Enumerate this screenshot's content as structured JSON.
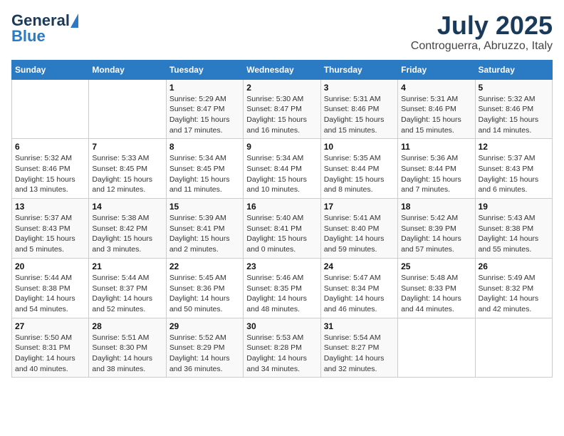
{
  "header": {
    "logo_general": "General",
    "logo_blue": "Blue",
    "title": "July 2025",
    "subtitle": "Controguerra, Abruzzo, Italy"
  },
  "weekdays": [
    "Sunday",
    "Monday",
    "Tuesday",
    "Wednesday",
    "Thursday",
    "Friday",
    "Saturday"
  ],
  "weeks": [
    [
      {
        "day": "",
        "content": ""
      },
      {
        "day": "",
        "content": ""
      },
      {
        "day": "1",
        "content": "Sunrise: 5:29 AM\nSunset: 8:47 PM\nDaylight: 15 hours\nand 17 minutes."
      },
      {
        "day": "2",
        "content": "Sunrise: 5:30 AM\nSunset: 8:47 PM\nDaylight: 15 hours\nand 16 minutes."
      },
      {
        "day": "3",
        "content": "Sunrise: 5:31 AM\nSunset: 8:46 PM\nDaylight: 15 hours\nand 15 minutes."
      },
      {
        "day": "4",
        "content": "Sunrise: 5:31 AM\nSunset: 8:46 PM\nDaylight: 15 hours\nand 15 minutes."
      },
      {
        "day": "5",
        "content": "Sunrise: 5:32 AM\nSunset: 8:46 PM\nDaylight: 15 hours\nand 14 minutes."
      }
    ],
    [
      {
        "day": "6",
        "content": "Sunrise: 5:32 AM\nSunset: 8:46 PM\nDaylight: 15 hours\nand 13 minutes."
      },
      {
        "day": "7",
        "content": "Sunrise: 5:33 AM\nSunset: 8:45 PM\nDaylight: 15 hours\nand 12 minutes."
      },
      {
        "day": "8",
        "content": "Sunrise: 5:34 AM\nSunset: 8:45 PM\nDaylight: 15 hours\nand 11 minutes."
      },
      {
        "day": "9",
        "content": "Sunrise: 5:34 AM\nSunset: 8:44 PM\nDaylight: 15 hours\nand 10 minutes."
      },
      {
        "day": "10",
        "content": "Sunrise: 5:35 AM\nSunset: 8:44 PM\nDaylight: 15 hours\nand 8 minutes."
      },
      {
        "day": "11",
        "content": "Sunrise: 5:36 AM\nSunset: 8:44 PM\nDaylight: 15 hours\nand 7 minutes."
      },
      {
        "day": "12",
        "content": "Sunrise: 5:37 AM\nSunset: 8:43 PM\nDaylight: 15 hours\nand 6 minutes."
      }
    ],
    [
      {
        "day": "13",
        "content": "Sunrise: 5:37 AM\nSunset: 8:43 PM\nDaylight: 15 hours\nand 5 minutes."
      },
      {
        "day": "14",
        "content": "Sunrise: 5:38 AM\nSunset: 8:42 PM\nDaylight: 15 hours\nand 3 minutes."
      },
      {
        "day": "15",
        "content": "Sunrise: 5:39 AM\nSunset: 8:41 PM\nDaylight: 15 hours\nand 2 minutes."
      },
      {
        "day": "16",
        "content": "Sunrise: 5:40 AM\nSunset: 8:41 PM\nDaylight: 15 hours\nand 0 minutes."
      },
      {
        "day": "17",
        "content": "Sunrise: 5:41 AM\nSunset: 8:40 PM\nDaylight: 14 hours\nand 59 minutes."
      },
      {
        "day": "18",
        "content": "Sunrise: 5:42 AM\nSunset: 8:39 PM\nDaylight: 14 hours\nand 57 minutes."
      },
      {
        "day": "19",
        "content": "Sunrise: 5:43 AM\nSunset: 8:38 PM\nDaylight: 14 hours\nand 55 minutes."
      }
    ],
    [
      {
        "day": "20",
        "content": "Sunrise: 5:44 AM\nSunset: 8:38 PM\nDaylight: 14 hours\nand 54 minutes."
      },
      {
        "day": "21",
        "content": "Sunrise: 5:44 AM\nSunset: 8:37 PM\nDaylight: 14 hours\nand 52 minutes."
      },
      {
        "day": "22",
        "content": "Sunrise: 5:45 AM\nSunset: 8:36 PM\nDaylight: 14 hours\nand 50 minutes."
      },
      {
        "day": "23",
        "content": "Sunrise: 5:46 AM\nSunset: 8:35 PM\nDaylight: 14 hours\nand 48 minutes."
      },
      {
        "day": "24",
        "content": "Sunrise: 5:47 AM\nSunset: 8:34 PM\nDaylight: 14 hours\nand 46 minutes."
      },
      {
        "day": "25",
        "content": "Sunrise: 5:48 AM\nSunset: 8:33 PM\nDaylight: 14 hours\nand 44 minutes."
      },
      {
        "day": "26",
        "content": "Sunrise: 5:49 AM\nSunset: 8:32 PM\nDaylight: 14 hours\nand 42 minutes."
      }
    ],
    [
      {
        "day": "27",
        "content": "Sunrise: 5:50 AM\nSunset: 8:31 PM\nDaylight: 14 hours\nand 40 minutes."
      },
      {
        "day": "28",
        "content": "Sunrise: 5:51 AM\nSunset: 8:30 PM\nDaylight: 14 hours\nand 38 minutes."
      },
      {
        "day": "29",
        "content": "Sunrise: 5:52 AM\nSunset: 8:29 PM\nDaylight: 14 hours\nand 36 minutes."
      },
      {
        "day": "30",
        "content": "Sunrise: 5:53 AM\nSunset: 8:28 PM\nDaylight: 14 hours\nand 34 minutes."
      },
      {
        "day": "31",
        "content": "Sunrise: 5:54 AM\nSunset: 8:27 PM\nDaylight: 14 hours\nand 32 minutes."
      },
      {
        "day": "",
        "content": ""
      },
      {
        "day": "",
        "content": ""
      }
    ]
  ]
}
